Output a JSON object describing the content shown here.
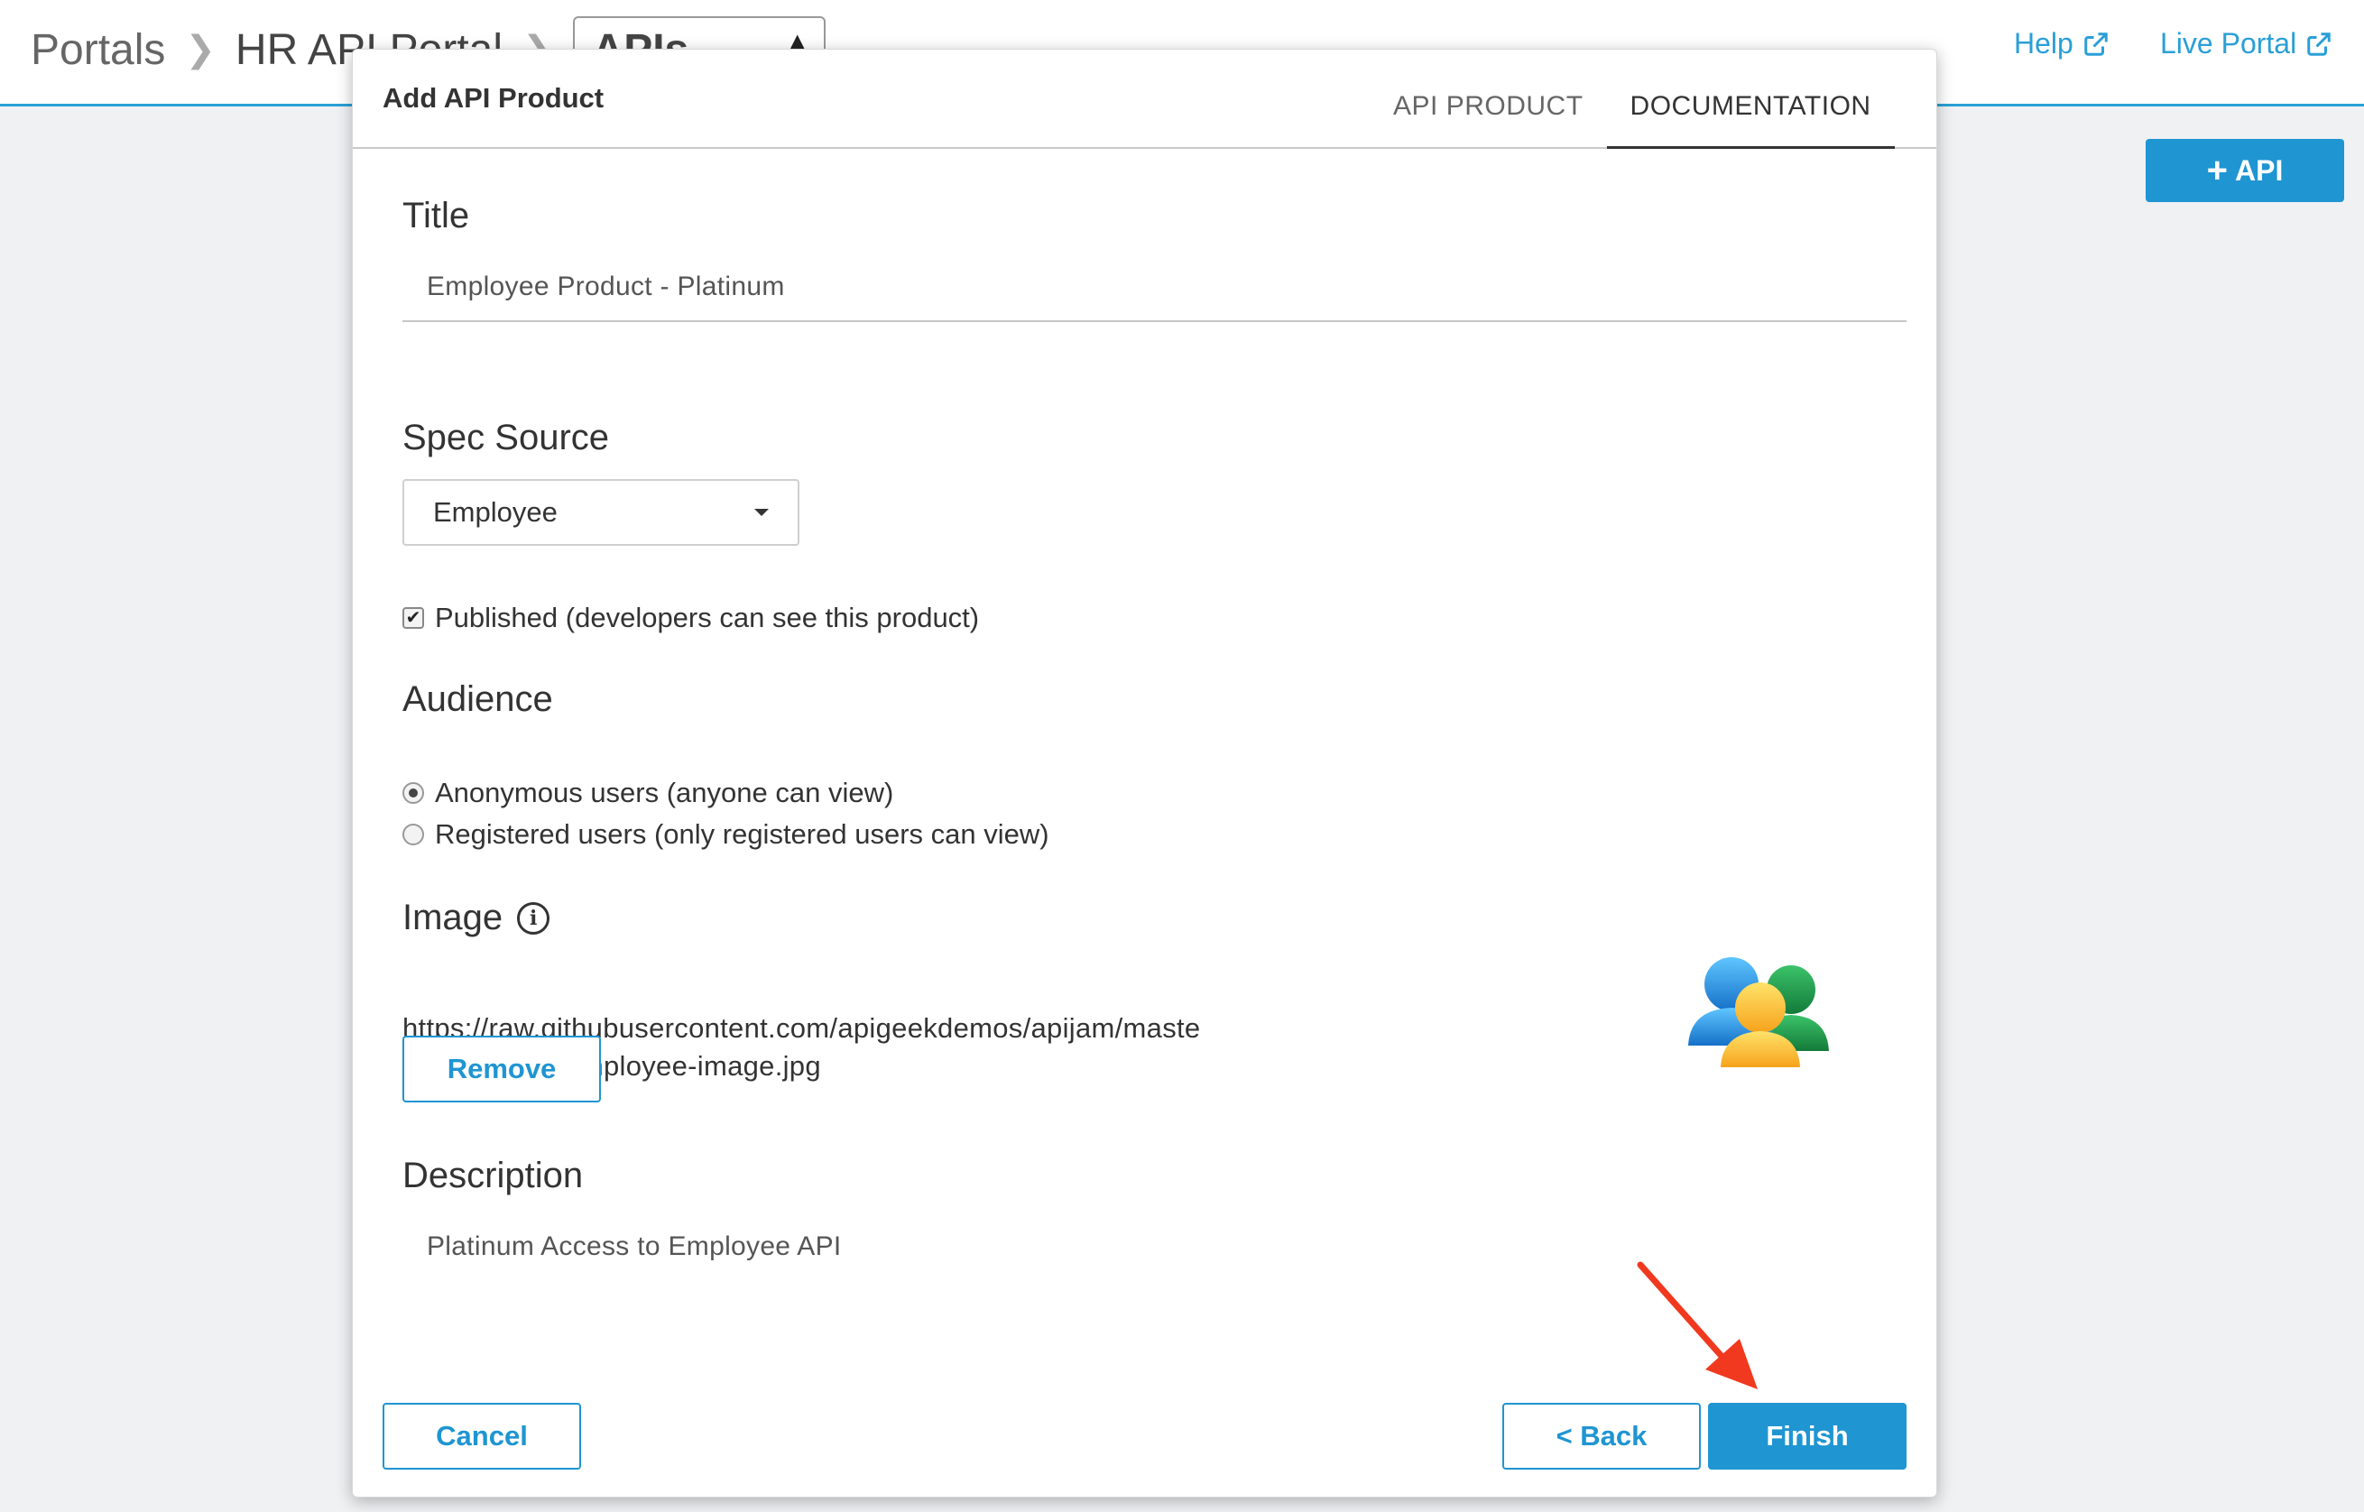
{
  "breadcrumb": {
    "items": [
      "Portals",
      "HR API Portal"
    ],
    "current": "APIs"
  },
  "header": {
    "help_label": "Help",
    "live_portal_label": "Live Portal"
  },
  "page": {
    "add_api_label": "API"
  },
  "modal": {
    "title": "Add API Product",
    "tabs": [
      {
        "label": "API PRODUCT",
        "active": false
      },
      {
        "label": "DOCUMENTATION",
        "active": true
      }
    ],
    "title_field": {
      "label": "Title",
      "value": "Employee Product - Platinum"
    },
    "spec_source": {
      "label": "Spec Source",
      "selected": "Employee"
    },
    "published": {
      "label": "Published (developers can see this product)",
      "checked": true
    },
    "audience": {
      "label": "Audience",
      "options": [
        {
          "label": "Anonymous users (anyone can view)",
          "selected": true
        },
        {
          "label": "Registered users (only registered users can view)",
          "selected": false
        }
      ]
    },
    "image": {
      "label": "Image",
      "url": "https://raw.githubusercontent.com/apigeekdemos/apijam/master/Resources/employee-image.jpg",
      "remove_label": "Remove",
      "preview_icon": "people-group-icon"
    },
    "description": {
      "label": "Description",
      "value": "Platinum Access to Employee API"
    },
    "footer": {
      "cancel_label": "Cancel",
      "back_label": "< Back",
      "finish_label": "Finish"
    }
  },
  "colors": {
    "accent": "#1f95d2",
    "annotation_arrow": "#f0391e"
  }
}
